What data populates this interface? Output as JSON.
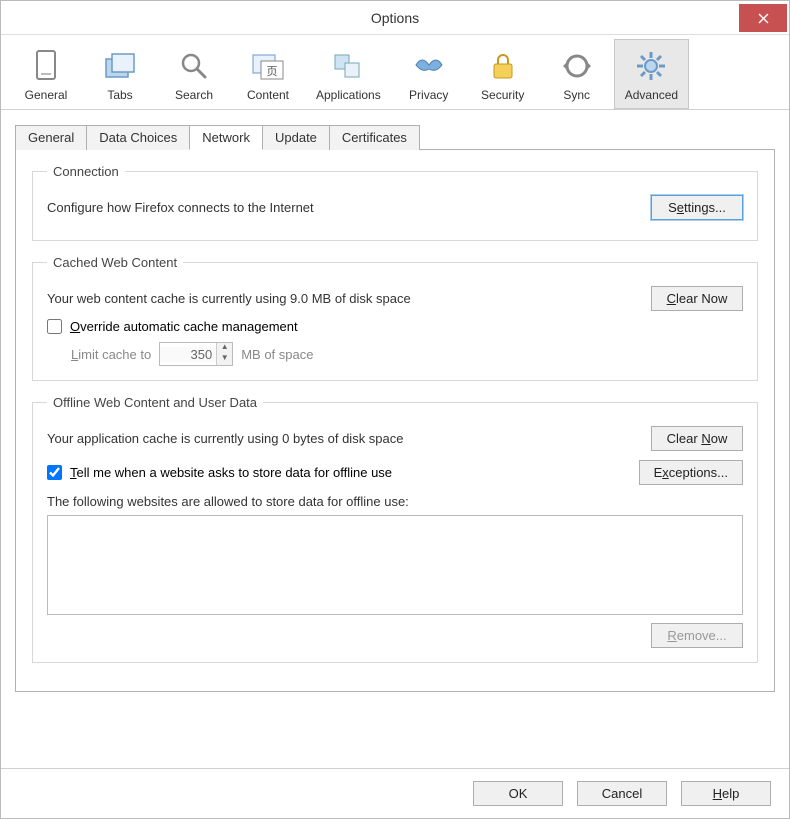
{
  "window": {
    "title": "Options"
  },
  "toolbar": {
    "items": [
      {
        "name": "general",
        "label": "General"
      },
      {
        "name": "tabs",
        "label": "Tabs"
      },
      {
        "name": "search",
        "label": "Search"
      },
      {
        "name": "content",
        "label": "Content"
      },
      {
        "name": "applications",
        "label": "Applications"
      },
      {
        "name": "privacy",
        "label": "Privacy"
      },
      {
        "name": "security",
        "label": "Security"
      },
      {
        "name": "sync",
        "label": "Sync"
      },
      {
        "name": "advanced",
        "label": "Advanced"
      }
    ]
  },
  "subtabs": {
    "items": [
      {
        "label": "General"
      },
      {
        "label": "Data Choices"
      },
      {
        "label": "Network"
      },
      {
        "label": "Update"
      },
      {
        "label": "Certificates"
      }
    ],
    "active_index": 2
  },
  "connection": {
    "legend": "Connection",
    "desc": "Configure how Firefox connects to the Internet",
    "settings_btn": "Settings..."
  },
  "cache": {
    "legend": "Cached Web Content",
    "desc": "Your web content cache is currently using 9.0 MB of disk space",
    "clear_btn": "Clear Now",
    "override_label": "Override automatic cache management",
    "override_checked": false,
    "limit_prefix": "Limit cache to",
    "limit_value": "350",
    "limit_suffix": "MB of space"
  },
  "offline": {
    "legend": "Offline Web Content and User Data",
    "desc": "Your application cache is currently using 0 bytes of disk space",
    "clear_btn": "Clear Now",
    "tell_label": "Tell me when a website asks to store data for offline use",
    "tell_checked": true,
    "exceptions_btn": "Exceptions...",
    "allowed_label": "The following websites are allowed to store data for offline use:",
    "remove_btn": "Remove..."
  },
  "footer": {
    "ok": "OK",
    "cancel": "Cancel",
    "help": "Help"
  }
}
